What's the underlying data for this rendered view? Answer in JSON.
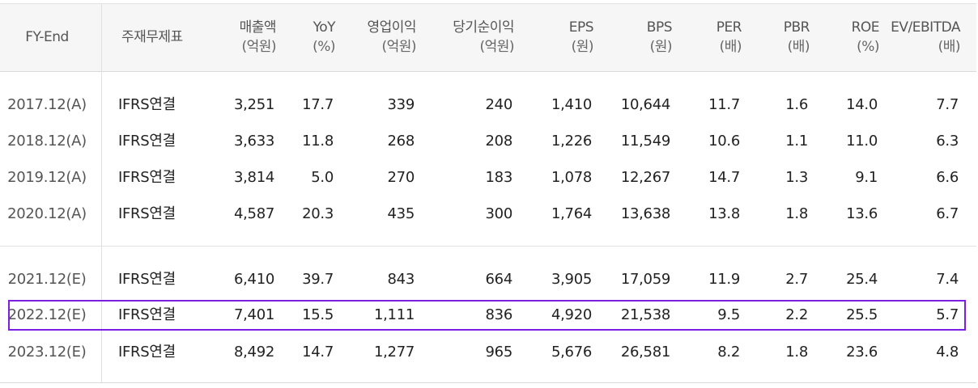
{
  "table": {
    "headers": [
      {
        "label": "FY-End",
        "unit": ""
      },
      {
        "label": "주재무제표",
        "unit": ""
      },
      {
        "label": "매출액",
        "unit": "(억원)"
      },
      {
        "label": "YoY",
        "unit": "(%)"
      },
      {
        "label": "영업이익",
        "unit": "(억원)"
      },
      {
        "label": "당기순이익",
        "unit": "(억원)"
      },
      {
        "label": "EPS",
        "unit": "(원)"
      },
      {
        "label": "BPS",
        "unit": "(원)"
      },
      {
        "label": "PER",
        "unit": "(배)"
      },
      {
        "label": "PBR",
        "unit": "(배)"
      },
      {
        "label": "ROE",
        "unit": "(%)"
      },
      {
        "label": "EV/EBITDA",
        "unit": "(배)"
      }
    ],
    "rows": [
      [
        "2017.12(A)",
        "IFRS연결",
        "3,251",
        "17.7",
        "339",
        "240",
        "1,410",
        "10,644",
        "11.7",
        "1.6",
        "14.0",
        "7.7"
      ],
      [
        "2018.12(A)",
        "IFRS연결",
        "3,633",
        "11.8",
        "268",
        "208",
        "1,226",
        "11,549",
        "10.6",
        "1.1",
        "11.0",
        "6.3"
      ],
      [
        "2019.12(A)",
        "IFRS연결",
        "3,814",
        "5.0",
        "270",
        "183",
        "1,078",
        "12,267",
        "14.7",
        "1.3",
        "9.1",
        "6.6"
      ],
      [
        "2020.12(A)",
        "IFRS연결",
        "4,587",
        "20.3",
        "435",
        "300",
        "1,764",
        "13,638",
        "13.8",
        "1.8",
        "13.6",
        "6.7"
      ],
      [
        "2021.12(E)",
        "IFRS연결",
        "6,410",
        "39.7",
        "843",
        "664",
        "3,905",
        "17,059",
        "11.9",
        "2.7",
        "25.4",
        "7.4"
      ],
      [
        "2022.12(E)",
        "IFRS연결",
        "7,401",
        "15.5",
        "1,111",
        "836",
        "4,920",
        "21,538",
        "9.5",
        "2.2",
        "25.5",
        "5.7"
      ],
      [
        "2023.12(E)",
        "IFRS연결",
        "8,492",
        "14.7",
        "1,277",
        "965",
        "5,676",
        "26,581",
        "8.2",
        "1.8",
        "23.6",
        "4.8"
      ]
    ],
    "highlighted_row": "2022.12(E)",
    "highlight_color": "#7b1fe0"
  }
}
